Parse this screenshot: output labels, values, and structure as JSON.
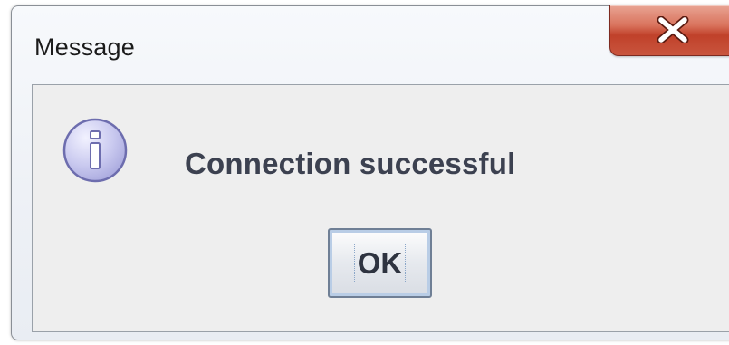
{
  "dialog": {
    "title": "Message",
    "close_icon": "close-icon",
    "info_icon": "information-icon",
    "message": "Connection successful",
    "ok_label": "OK"
  },
  "colors": {
    "close_button": "#c9553e",
    "info_icon_fill": "#c8c8f0",
    "dialog_background": "#eeeeee"
  }
}
